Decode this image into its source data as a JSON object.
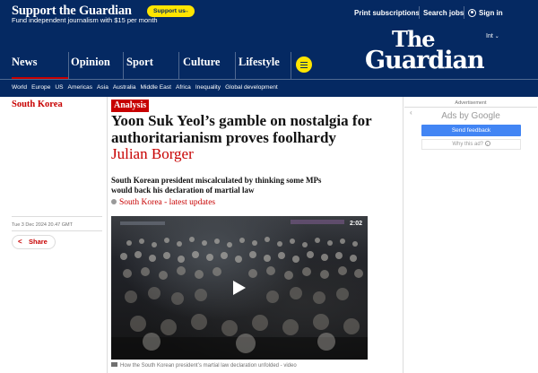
{
  "support": {
    "title": "Support the Guardian",
    "subtitle": "Fund independent journalism with $15 per month",
    "button_label": "Support us",
    "button_arrow": "→"
  },
  "top_links": {
    "print_subscriptions": "Print subscriptions",
    "search_jobs": "Search jobs",
    "sign_in": "Sign in"
  },
  "edition": "Int",
  "logo": {
    "line1": "The",
    "line2": "Guardian"
  },
  "pillars": [
    "News",
    "Opinion",
    "Sport",
    "Culture",
    "Lifestyle"
  ],
  "subnav": [
    "World",
    "Europe",
    "US",
    "Americas",
    "Asia",
    "Australia",
    "Middle East",
    "Africa",
    "Inequality",
    "Global development"
  ],
  "article": {
    "section": "South Korea",
    "kicker": "Analysis",
    "headline": "Yoon Suk Yeol’s gamble on nostalgia for authoritarianism proves foolhardy",
    "byline": "Julian Borger",
    "standfirst": "South Korean president miscalculated by thinking some MPs would back his declaration of martial law",
    "live_link": "South Korea - latest updates",
    "timestamp": "Tue 3 Dec 2024 20.47 GMT",
    "share_label": "Share",
    "video_duration": "2:02",
    "caption": "How the South Korean president’s martial law declaration unfolded - video"
  },
  "ad": {
    "label": "Advertisement",
    "back_arrow": "‹",
    "ads_by": "Ads by Google",
    "send_feedback": "Send feedback",
    "why_this_ad": "Why this ad?",
    "info_glyph": "i"
  },
  "colors": {
    "brand_blue": "#052962",
    "news_red": "#c70000",
    "support_yellow": "#ffe500",
    "google_blue": "#4285f4"
  }
}
